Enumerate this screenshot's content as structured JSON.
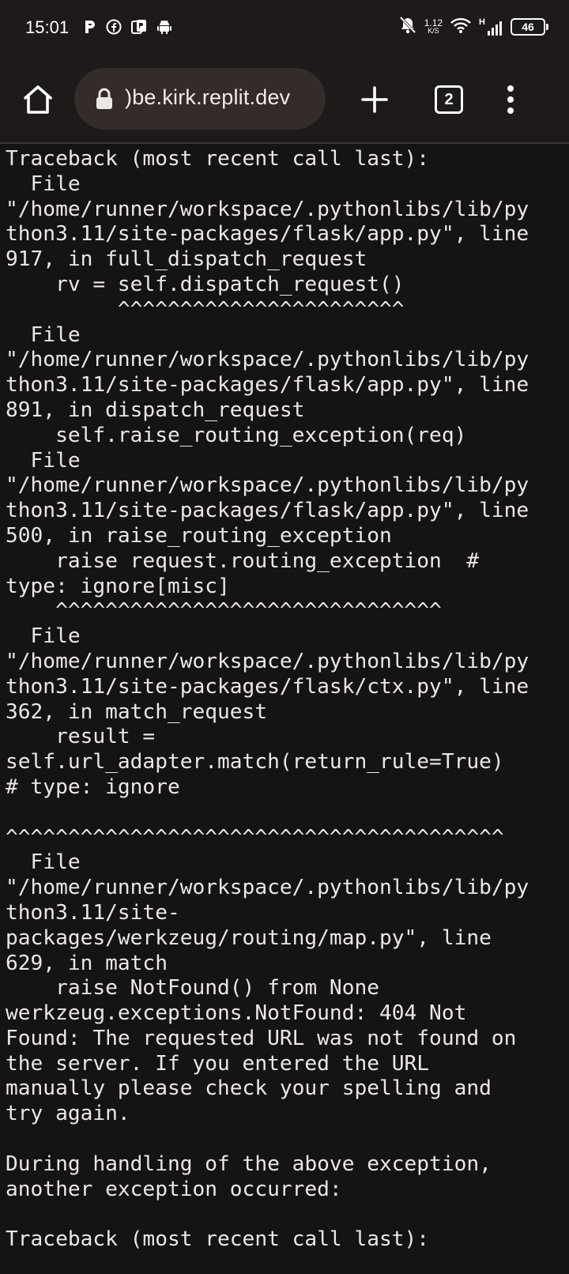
{
  "status_bar": {
    "time": "15:01",
    "left_icons": [
      "parking-app-icon",
      "facebook-icon",
      "pdf-app-icon",
      "android-icon"
    ],
    "right_icons": [
      "mute-notifications-icon",
      "network-speed",
      "wifi-icon",
      "cellular-signal-icon",
      "battery-icon"
    ],
    "net_speed_value": "1.12",
    "net_speed_unit": "K/S",
    "signal_type": "H",
    "battery_level": "46"
  },
  "toolbar": {
    "url": ")be.kirk.replit.dev",
    "tab_count": "2",
    "icons": [
      "home-icon",
      "lock-icon",
      "plus-icon",
      "tabs-icon",
      "more-vertical-icon"
    ]
  },
  "page": {
    "lines": [
      "Traceback (most recent call last):",
      "  File",
      "\"/home/runner/workspace/.pythonlibs/lib/py",
      "thon3.11/site-packages/flask/app.py\", line",
      "917, in full_dispatch_request",
      "    rv = self.dispatch_request()",
      "         ^^^^^^^^^^^^^^^^^^^^^^^",
      "  File",
      "\"/home/runner/workspace/.pythonlibs/lib/py",
      "thon3.11/site-packages/flask/app.py\", line",
      "891, in dispatch_request",
      "    self.raise_routing_exception(req)",
      "  File",
      "\"/home/runner/workspace/.pythonlibs/lib/py",
      "thon3.11/site-packages/flask/app.py\", line",
      "500, in raise_routing_exception",
      "    raise request.routing_exception  #",
      "type: ignore[misc]",
      "    ^^^^^^^^^^^^^^^^^^^^^^^^^^^^^^^",
      "  File",
      "\"/home/runner/workspace/.pythonlibs/lib/py",
      "thon3.11/site-packages/flask/ctx.py\", line",
      "362, in match_request",
      "    result =",
      "self.url_adapter.match(return_rule=True)",
      "# type: ignore",
      "",
      "^^^^^^^^^^^^^^^^^^^^^^^^^^^^^^^^^^^^^^^^",
      "  File",
      "\"/home/runner/workspace/.pythonlibs/lib/py",
      "thon3.11/site-",
      "packages/werkzeug/routing/map.py\", line",
      "629, in match",
      "    raise NotFound() from None",
      "werkzeug.exceptions.NotFound: 404 Not",
      "Found: The requested URL was not found on",
      "the server. If you entered the URL",
      "manually please check your spelling and",
      "try again.",
      "",
      "During handling of the above exception,",
      "another exception occurred:",
      "",
      "Traceback (most recent call last):"
    ]
  }
}
